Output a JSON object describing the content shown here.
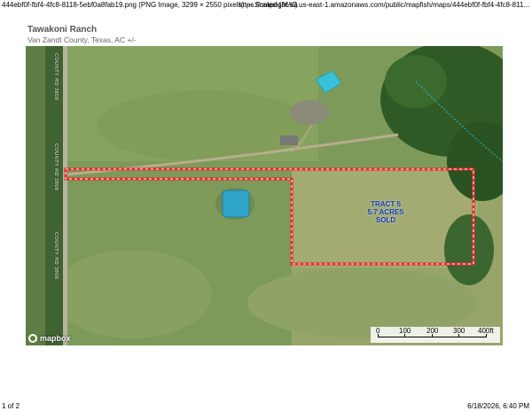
{
  "header": {
    "left": "444ebf0f-fbf4-4fc8-8118-5ebf0a8fab19.png (PNG Image, 3299 × 2550 pixels) — Scaled (36%)",
    "right": "https://mapright.s3.us-east-1.amazonaws.com/public/mapfish/maps/444ebf0f-fbf4-4fc8-811..."
  },
  "map": {
    "title": "Tawakoni Ranch",
    "subtitle": "Van Zandt County, Texas, AC +/-",
    "tract_label": [
      "TRACT 5",
      "5.7 ACRES",
      "SOLD"
    ],
    "road_label": "COUNTY RD 3808",
    "mapbox": "mapbox",
    "scale": {
      "labels": [
        "0",
        "100",
        "200",
        "300",
        "400ft"
      ]
    },
    "colors": {
      "boundary": "#e32b2b",
      "water": "#2fa6c9",
      "label": "#1b3ea8"
    }
  },
  "footer": {
    "page": "1 of 2",
    "datetime": "6/18/2026, 6:40 PM"
  }
}
